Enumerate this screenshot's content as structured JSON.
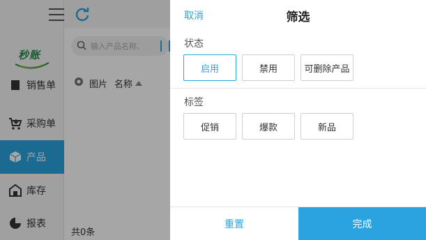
{
  "app": {
    "logo_text": "秒账",
    "nav": [
      {
        "label": "销售单",
        "icon": "receipt-icon"
      },
      {
        "label": "采购单",
        "icon": "cart-icon"
      },
      {
        "label": "产品",
        "icon": "box-icon"
      },
      {
        "label": "库存",
        "icon": "warehouse-icon"
      },
      {
        "label": "报表",
        "icon": "pie-chart-icon"
      }
    ],
    "active_nav": "产品",
    "search_placeholder": "输入产品名称、",
    "table_headers": {
      "image": "图片",
      "name": "名称"
    },
    "footer_count": "共0条"
  },
  "filter": {
    "cancel_label": "取消",
    "title": "筛选",
    "status_label": "状态",
    "status_options": [
      "启用",
      "禁用",
      "可删除产品"
    ],
    "status_selected": "启用",
    "tag_label": "标签",
    "tag_options": [
      "促销",
      "爆款",
      "新品"
    ],
    "reset_label": "重置",
    "done_label": "完成"
  },
  "colors": {
    "accent": "#2aa3e0",
    "overlay": "rgba(0,0,0,0.35)"
  }
}
